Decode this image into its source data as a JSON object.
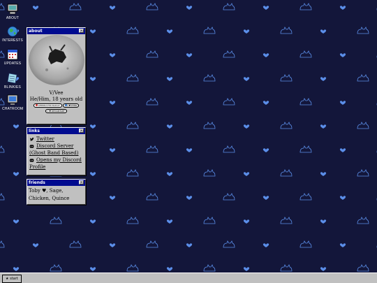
{
  "desktop": {
    "icons": [
      {
        "id": "about",
        "label": "ABOUT",
        "icon": "computer-icon"
      },
      {
        "id": "interests",
        "label": "INTERESTS",
        "icon": "globe-icon"
      },
      {
        "id": "updates",
        "label": "UPDATES",
        "icon": "calendar-icon"
      },
      {
        "id": "blinkies",
        "label": "BLINKIES",
        "icon": "paper-icon"
      },
      {
        "id": "chatroom",
        "label": "CHATROOM",
        "icon": "monitor-icon"
      }
    ]
  },
  "windows": {
    "about": {
      "title": "about",
      "name": "V/Vee",
      "pronouns": "He/Him, 18 years old",
      "badges": [
        "WEBMASTER BADGE",
        "I ♥ HTML",
        "I ♥ DEVIANTART"
      ]
    },
    "links": {
      "title": "links",
      "items": [
        {
          "text": "Twitter",
          "icon": "twitter-icon"
        },
        {
          "text": "Discord Server (Ghost Band Based)",
          "icon": "discord-icon"
        },
        {
          "text": "Opens my Discord Profile",
          "icon": "discord-icon"
        }
      ]
    },
    "friends": {
      "title": "friends",
      "text_before_heart": "Toby",
      "text_after_heart": ", Sage, Chicken, Quince"
    }
  },
  "taskbar": {
    "start_label": "start",
    "start_icon": "star-icon"
  },
  "colors": {
    "background": "#13163a",
    "pattern": "#5b8ee8",
    "titlebar": "#000b8f",
    "window": "#c0c0c0"
  }
}
